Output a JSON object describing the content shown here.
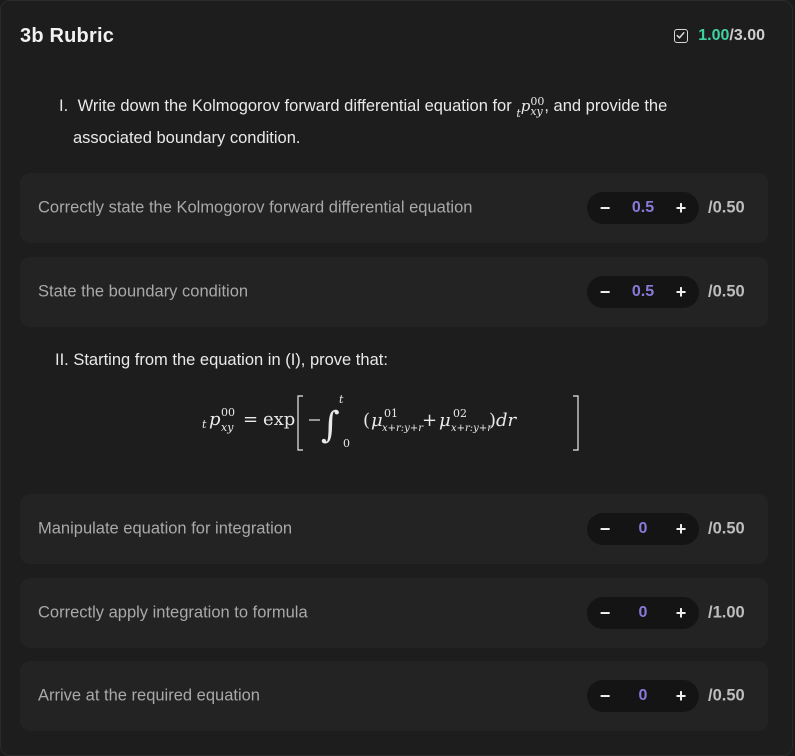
{
  "header": {
    "title": "3b Rubric",
    "score_earned": "1.00",
    "score_separator": "/",
    "score_total": "3.00"
  },
  "questions": {
    "q1": {
      "number": "I.",
      "text_before": "Write down the Kolmogorov forward differential equation for",
      "text_after": "and provide the",
      "line2": "associated boundary condition."
    },
    "q2": {
      "text": "II. Starting from the equation in (I), prove that:"
    }
  },
  "criteria": [
    {
      "label": "Correctly state the Kolmogorov forward differential equation",
      "value": "0.5",
      "max": "/0.50"
    },
    {
      "label": "State the boundary condition",
      "value": "0.5",
      "max": "/0.50"
    },
    {
      "label": "Manipulate equation for integration",
      "value": "0",
      "max": "/0.50"
    },
    {
      "label": "Correctly apply integration to formula",
      "value": "0",
      "max": "/1.00"
    },
    {
      "label": "Arrive at the required equation",
      "value": "0",
      "max": "/0.50"
    }
  ],
  "stepper": {
    "minus_label": "−",
    "plus_label": "+"
  },
  "colors": {
    "score_earned": "#3fd0a2",
    "stepper_value": "#8b79d9",
    "background": "#1b1b1c",
    "card": "#232324"
  },
  "icons": {
    "score": "checkbox-checked-icon"
  }
}
